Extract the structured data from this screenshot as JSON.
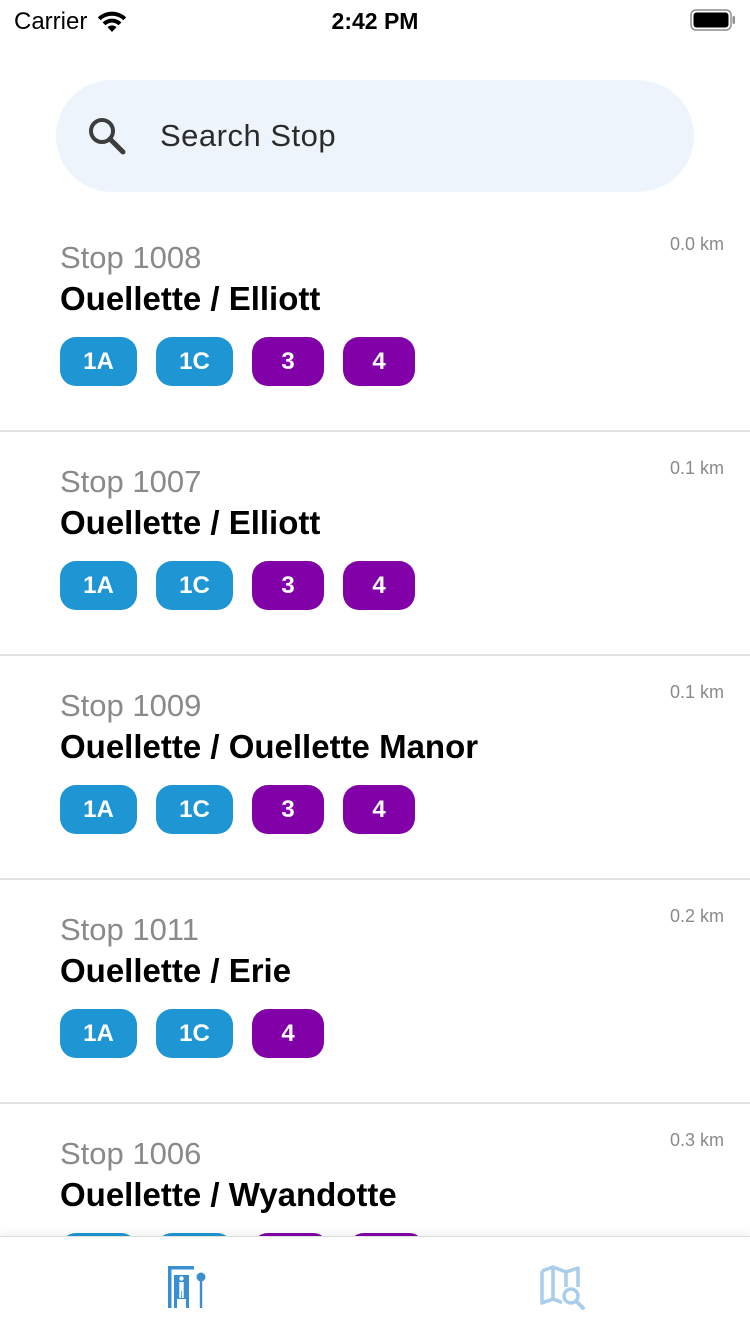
{
  "status_bar": {
    "carrier": "Carrier",
    "time": "2:42 PM"
  },
  "search": {
    "placeholder": "Search Stop",
    "value": ""
  },
  "colors": {
    "route_blue": "#1e96d4",
    "route_purple": "#8100a8",
    "accent": "#1e96d4"
  },
  "stops": [
    {
      "number": "Stop 1008",
      "name": "Ouellette / Elliott",
      "distance": "0.0 km",
      "routes": [
        {
          "label": "1A",
          "color": "blue"
        },
        {
          "label": "1C",
          "color": "blue"
        },
        {
          "label": "3",
          "color": "purple"
        },
        {
          "label": "4",
          "color": "purple"
        }
      ]
    },
    {
      "number": "Stop 1007",
      "name": "Ouellette / Elliott",
      "distance": "0.1 km",
      "routes": [
        {
          "label": "1A",
          "color": "blue"
        },
        {
          "label": "1C",
          "color": "blue"
        },
        {
          "label": "3",
          "color": "purple"
        },
        {
          "label": "4",
          "color": "purple"
        }
      ]
    },
    {
      "number": "Stop 1009",
      "name": "Ouellette / Ouellette Manor",
      "distance": "0.1 km",
      "routes": [
        {
          "label": "1A",
          "color": "blue"
        },
        {
          "label": "1C",
          "color": "blue"
        },
        {
          "label": "3",
          "color": "purple"
        },
        {
          "label": "4",
          "color": "purple"
        }
      ]
    },
    {
      "number": "Stop 1011",
      "name": "Ouellette / Erie",
      "distance": "0.2 km",
      "routes": [
        {
          "label": "1A",
          "color": "blue"
        },
        {
          "label": "1C",
          "color": "blue"
        },
        {
          "label": "4",
          "color": "purple"
        }
      ]
    },
    {
      "number": "Stop 1006",
      "name": "Ouellette / Wyandotte",
      "distance": "0.3 km",
      "routes": [
        {
          "label": "",
          "color": "blue"
        },
        {
          "label": "",
          "color": "blue"
        },
        {
          "label": "",
          "color": "purple"
        },
        {
          "label": "",
          "color": "purple"
        }
      ]
    }
  ],
  "tab_bar": {
    "tabs": [
      {
        "id": "stops",
        "icon": "bus-stop-icon"
      },
      {
        "id": "map",
        "icon": "map-search-icon"
      }
    ]
  }
}
